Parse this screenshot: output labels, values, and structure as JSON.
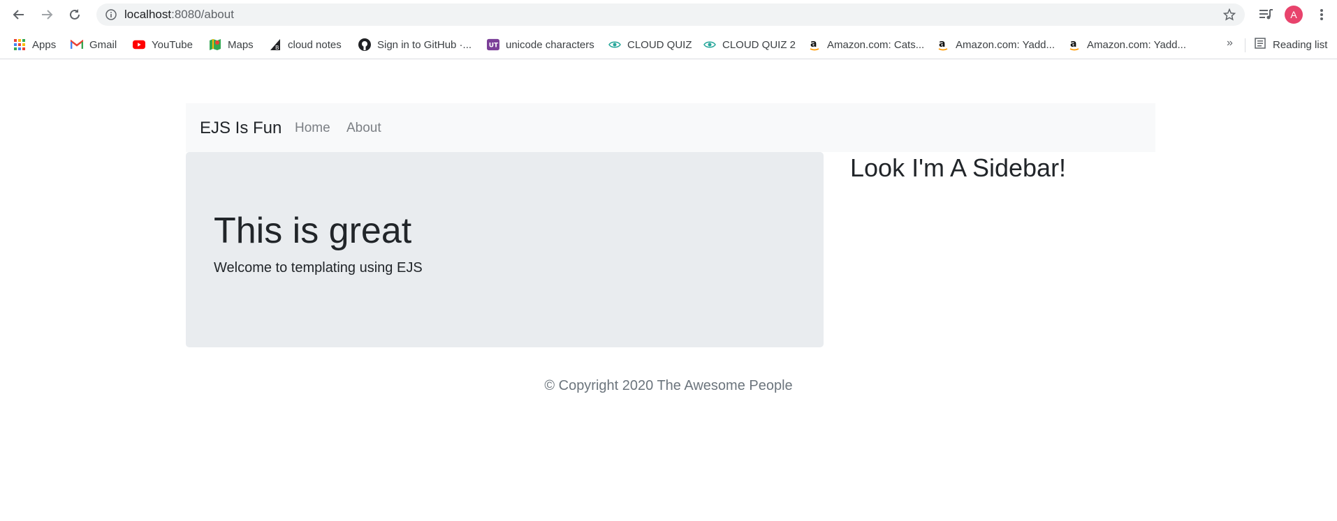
{
  "browser": {
    "url_host": "localhost",
    "url_path": ":8080/about",
    "avatar_letter": "A",
    "icons": {
      "back": "back-arrow-icon",
      "forward": "forward-arrow-icon",
      "reload": "reload-icon",
      "site_info": "info-icon",
      "bookmark": "star-icon",
      "media": "media-control-icon",
      "menu": "kebab-menu-icon"
    }
  },
  "bookmarks": {
    "items": [
      {
        "label": "Apps",
        "icon": "apps-grid-icon"
      },
      {
        "label": "Gmail",
        "icon": "gmail-icon"
      },
      {
        "label": "YouTube",
        "icon": "youtube-icon"
      },
      {
        "label": "Maps",
        "icon": "maps-icon"
      },
      {
        "label": "cloud notes",
        "icon": "cloud-notes-icon"
      },
      {
        "label": "Sign in to GitHub ·...",
        "icon": "github-icon"
      },
      {
        "label": "unicode characters",
        "icon": "unicode-icon"
      },
      {
        "label": "CLOUD QUIZ",
        "icon": "eye-icon"
      },
      {
        "label": "CLOUD QUIZ 2",
        "icon": "eye-icon"
      },
      {
        "label": "Amazon.com: Cats...",
        "icon": "amazon-icon"
      },
      {
        "label": "Amazon.com: Yadd...",
        "icon": "amazon-icon"
      },
      {
        "label": "Amazon.com: Yadd...",
        "icon": "amazon-icon"
      }
    ],
    "more": "»",
    "reading_list": "Reading list"
  },
  "navbar": {
    "brand": "EJS Is Fun",
    "links": [
      "Home",
      "About"
    ]
  },
  "jumbotron": {
    "title": "This is great",
    "subtitle": "Welcome to templating using EJS"
  },
  "sidebar": {
    "title": "Look I'm A Sidebar!"
  },
  "footer": {
    "text": "© Copyright 2020 The Awesome People"
  },
  "colors": {
    "navbar_bg": "#f8f9fa",
    "jumbotron_bg": "#e9ecef",
    "avatar": "#e8436c",
    "muted_text": "#6c757d"
  }
}
